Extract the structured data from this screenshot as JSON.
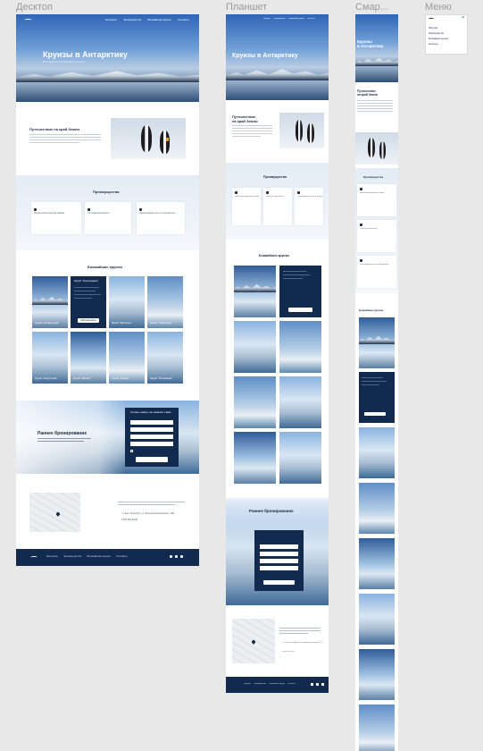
{
  "frames": {
    "desktop": "Десктоп",
    "tablet": "Планшет",
    "smartphone": "Смар...",
    "menu": "Меню"
  },
  "nav": [
    "Нагрузка",
    "Преимущества",
    "Ближайшие круизы",
    "Контакты"
  ],
  "hero": {
    "title": "Круизы в Антарктику",
    "title_mobile": "Круизы\nв Антарктику",
    "subtitle": "Исследуйте последний континент"
  },
  "intro": {
    "title": "Путешествие на край Земли",
    "title_tablet": "Путешествие\nна край Земли"
  },
  "advantages": {
    "title": "Преимущества",
    "items": [
      "Небольшой круизный лайнер",
      "Система озеленения",
      "Эксклюзивные места в Антарктике"
    ]
  },
  "cruises": {
    "title": "Ближайшие круизы",
    "cards": [
      "Круиз \"Антарктида\"",
      "Круиз \"Гренландия\"",
      "Круиз \"Мичиган\"",
      "Круиз \"Лабрадор\"",
      "Круиз \"Алеутская\"",
      "Круиз \"Фрегат\"",
      "Круиз \"Ушуая\"",
      "Круиз \"Полярный\""
    ],
    "button": "Забронировать"
  },
  "booking": {
    "title": "Раннее бронирование",
    "form_title": "Оставьте заявку и мы свяжемся с вами"
  },
  "contacts": {
    "address": "г. Санкт-Петербург, ул. Большая Конюшенная, 19/8",
    "phone": "8 800 800 80 88"
  },
  "menu_items": [
    "Нагрузка",
    "Преимущества",
    "Ближайшие круизы",
    "Контакты"
  ],
  "colors": {
    "navy": "#112a4e",
    "accent_light": "#e3ecf5"
  }
}
